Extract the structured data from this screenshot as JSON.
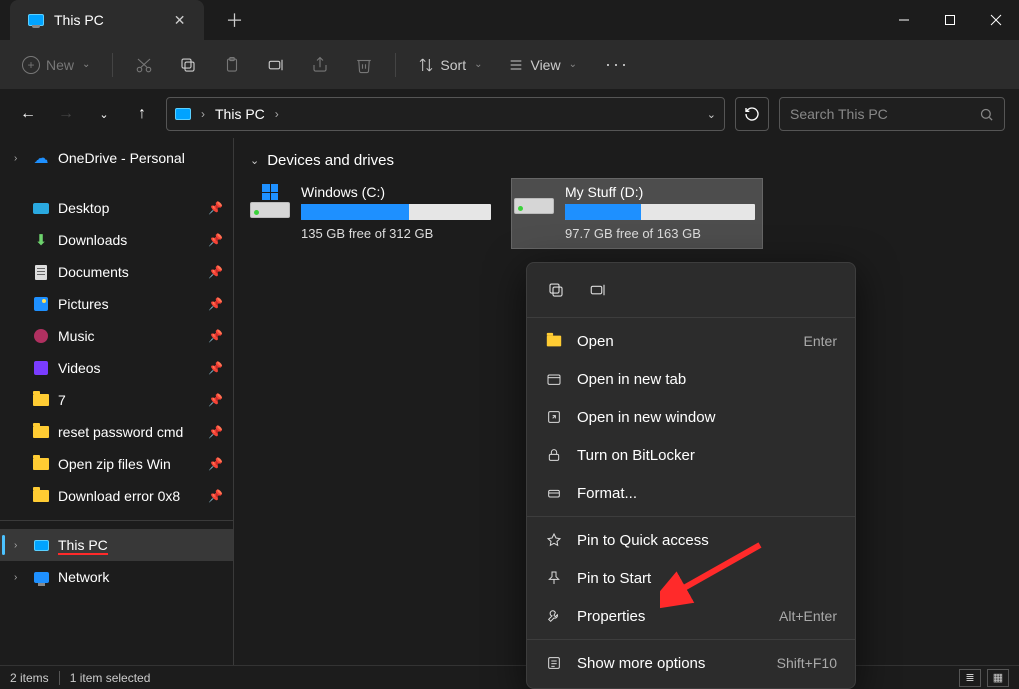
{
  "tab": {
    "title": "This PC"
  },
  "toolbar": {
    "new": "New",
    "sort": "Sort",
    "view": "View"
  },
  "address": {
    "crumb": "This PC",
    "search_placeholder": "Search This PC"
  },
  "sidebar": {
    "onedrive": "OneDrive - Personal",
    "quick": [
      {
        "label": "Desktop"
      },
      {
        "label": "Downloads"
      },
      {
        "label": "Documents"
      },
      {
        "label": "Pictures"
      },
      {
        "label": "Music"
      },
      {
        "label": "Videos"
      },
      {
        "label": "7"
      },
      {
        "label": "reset password cmd"
      },
      {
        "label": "Open zip files Win"
      },
      {
        "label": "Download error 0x8"
      }
    ],
    "thispc": "This PC",
    "network": "Network"
  },
  "section": {
    "title": "Devices and drives"
  },
  "drives": [
    {
      "name": "Windows (C:)",
      "free": "135 GB free of 312 GB",
      "used_pct": 57
    },
    {
      "name": "My Stuff (D:)",
      "free": "97.7 GB free of 163 GB",
      "used_pct": 40
    }
  ],
  "context_menu": {
    "items": [
      {
        "label": "Open",
        "shortcut": "Enter",
        "icon": "folder"
      },
      {
        "label": "Open in new tab",
        "icon": "tab"
      },
      {
        "label": "Open in new window",
        "icon": "window"
      },
      {
        "label": "Turn on BitLocker",
        "icon": "lock"
      },
      {
        "label": "Format...",
        "icon": "format"
      },
      {
        "label": "Pin to Quick access",
        "icon": "pin"
      },
      {
        "label": "Pin to Start",
        "icon": "pin"
      },
      {
        "label": "Properties",
        "shortcut": "Alt+Enter",
        "icon": "wrench"
      },
      {
        "label": "Show more options",
        "shortcut": "Shift+F10",
        "icon": "more"
      }
    ]
  },
  "status": {
    "count": "2 items",
    "selected": "1 item selected"
  }
}
